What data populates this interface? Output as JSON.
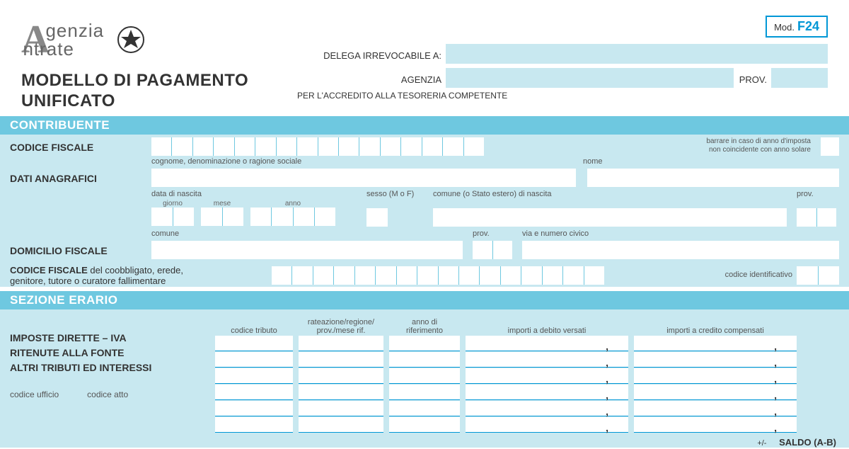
{
  "agency_name_l1": "genzia",
  "agency_name_l2": "ntrate",
  "mod_prefix": "Mod.",
  "mod_code": "F24",
  "form_title_l1": "MODELLO DI PAGAMENTO",
  "form_title_l2": "UNIFICATO",
  "delega_label": "DELEGA IRREVOCABILE A:",
  "agenzia_label": "AGENZIA",
  "prov_short": "PROV.",
  "tesoreria": "PER L'ACCREDITO ALLA TESORERIA COMPETENTE",
  "section_contribuente": "CONTRIBUENTE",
  "codice_fiscale": "CODICE FISCALE",
  "barrare_l1": "barrare in caso di anno d'imposta",
  "barrare_l2": "non coincidente con anno solare",
  "sub_cognome": "cognome, denominazione o ragione sociale",
  "sub_nome": "nome",
  "dati_anagrafici": "DATI ANAGRAFICI",
  "data_nascita": "data di nascita",
  "giorno": "giorno",
  "mese": "mese",
  "anno": "anno",
  "sesso": "sesso (M o F)",
  "comune_nascita": "comune (o Stato estero) di nascita",
  "prov_low": "prov.",
  "comune": "comune",
  "via": "via e numero civico",
  "domicilio": "DOMICILIO FISCALE",
  "coobb_b": "CODICE FISCALE",
  "coobb_rest": " del coobbligato, erede,",
  "coobb_l2": "genitore, tutore o curatore fallimentare",
  "codice_ident": "codice identificativo",
  "section_erario": "SEZIONE ERARIO",
  "codice_tributo": "codice tributo",
  "rateazione_l1": "rateazione/regione/",
  "rateazione_l2": "prov./mese rif.",
  "anno_rif_l1": "anno di",
  "anno_rif_l2": "riferimento",
  "debito": "importi a debito versati",
  "credito": "importi a credito compensati",
  "imposte": "IMPOSTE DIRETTE – IVA",
  "ritenute": "RITENUTE ALLA FONTE",
  "altri": "ALTRI TRIBUTI ED INTERESSI",
  "codice_ufficio": "codice ufficio",
  "codice_atto": "codice atto",
  "saldo_prefix": "+/-",
  "saldo": "SALDO  (A-B)"
}
